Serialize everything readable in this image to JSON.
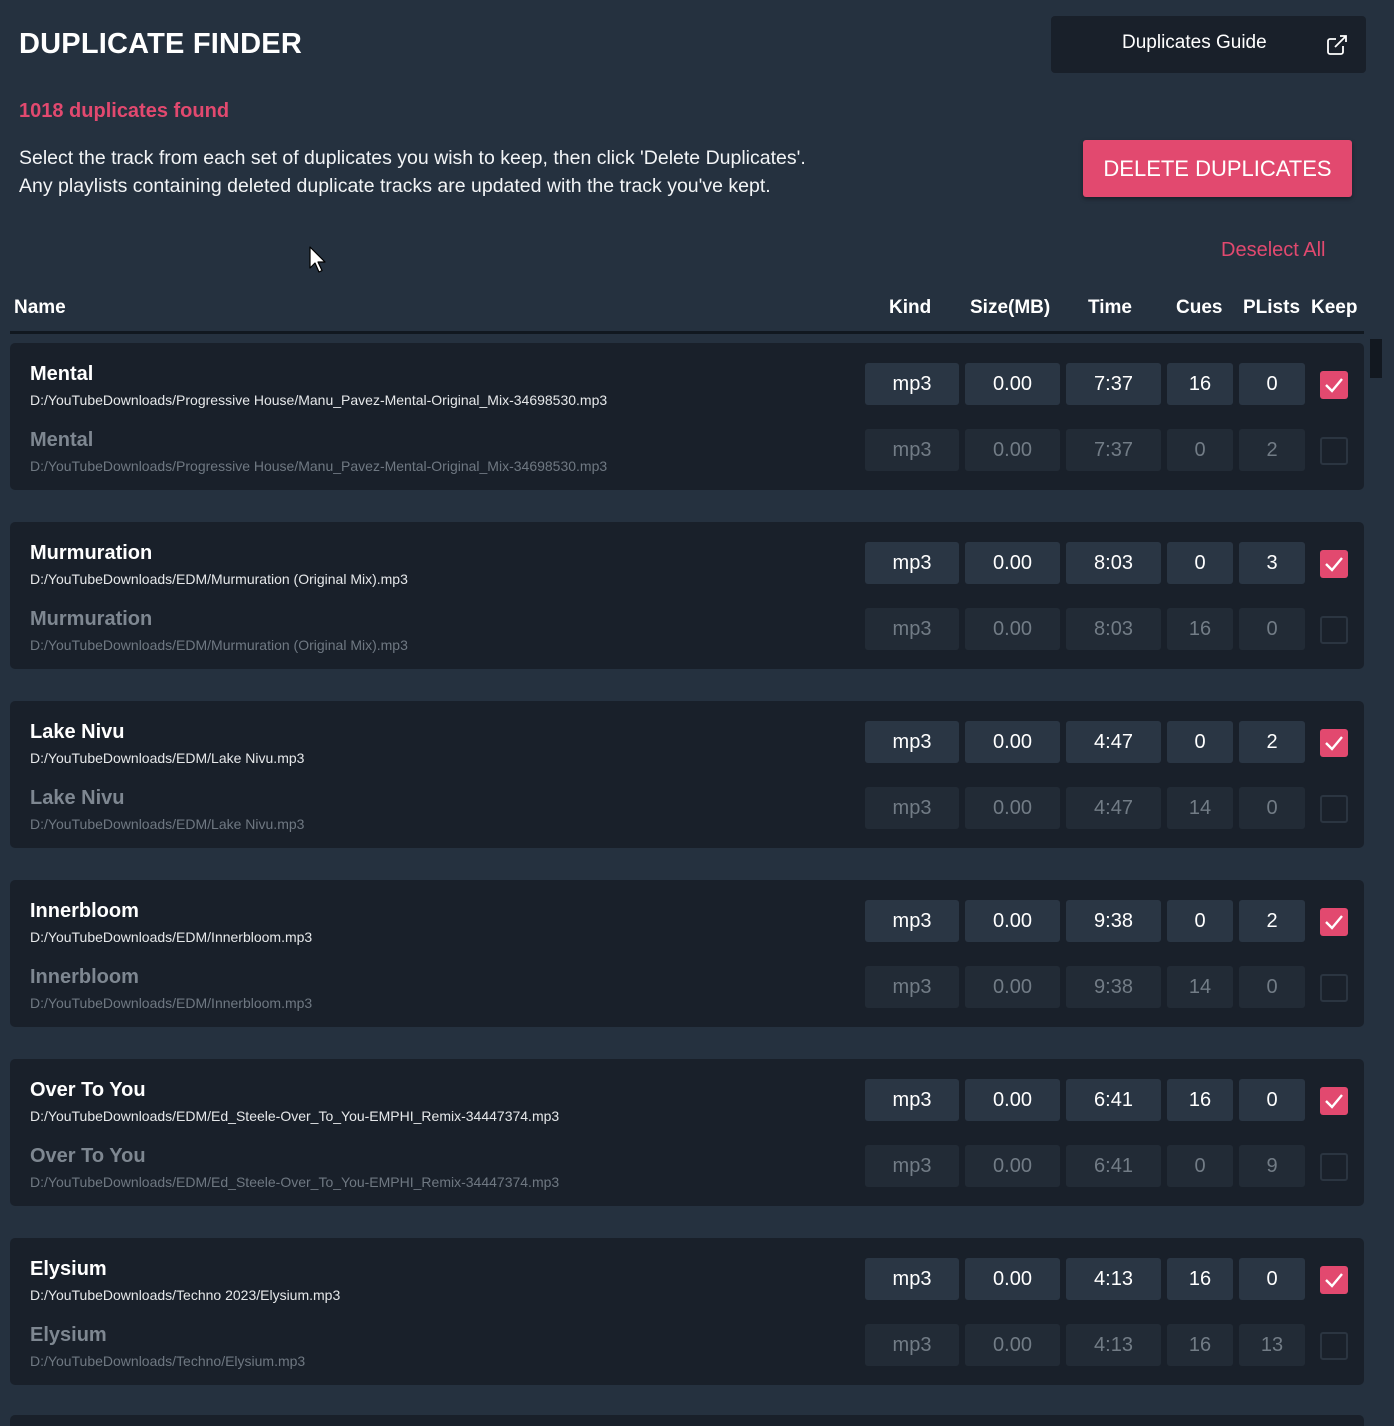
{
  "title": "DUPLICATE FINDER",
  "guide_button": {
    "label": "Duplicates Guide",
    "icon": "external-link-icon"
  },
  "count_text": "1018 duplicates found",
  "instructions": [
    "Select the track from each set of duplicates you wish to keep, then click 'Delete Duplicates'.",
    "Any playlists containing deleted duplicate tracks are updated with the track you've kept."
  ],
  "delete_button": {
    "label": "DELETE DUPLICATES"
  },
  "deselect_all": "Deselect All",
  "columns": [
    "Name",
    "Kind",
    "Size(MB)",
    "Time",
    "Cues",
    "PLists",
    "Keep"
  ],
  "colors": {
    "accent": "#e2496f",
    "background": "#25313f",
    "card": "#19202a",
    "cell": "#2a3644"
  },
  "groups": [
    {
      "tracks": [
        {
          "name": "Mental",
          "path": "D:/YouTubeDownloads/Progressive House/Manu_Pavez-Mental-Original_Mix-34698530.mp3",
          "kind": "mp3",
          "size": "0.00",
          "time": "7:37",
          "cues": "16",
          "plists": "0",
          "keep": true
        },
        {
          "name": "Mental",
          "path": "D:/YouTubeDownloads/Progressive House/Manu_Pavez-Mental-Original_Mix-34698530.mp3",
          "kind": "mp3",
          "size": "0.00",
          "time": "7:37",
          "cues": "0",
          "plists": "2",
          "keep": false
        }
      ]
    },
    {
      "tracks": [
        {
          "name": "Murmuration",
          "path": "D:/YouTubeDownloads/EDM/Murmuration (Original Mix).mp3",
          "kind": "mp3",
          "size": "0.00",
          "time": "8:03",
          "cues": "0",
          "plists": "3",
          "keep": true
        },
        {
          "name": "Murmuration",
          "path": "D:/YouTubeDownloads/EDM/Murmuration (Original Mix).mp3",
          "kind": "mp3",
          "size": "0.00",
          "time": "8:03",
          "cues": "16",
          "plists": "0",
          "keep": false
        }
      ]
    },
    {
      "tracks": [
        {
          "name": "Lake Nivu",
          "path": "D:/YouTubeDownloads/EDM/Lake Nivu.mp3",
          "kind": "mp3",
          "size": "0.00",
          "time": "4:47",
          "cues": "0",
          "plists": "2",
          "keep": true
        },
        {
          "name": "Lake Nivu",
          "path": "D:/YouTubeDownloads/EDM/Lake Nivu.mp3",
          "kind": "mp3",
          "size": "0.00",
          "time": "4:47",
          "cues": "14",
          "plists": "0",
          "keep": false
        }
      ]
    },
    {
      "tracks": [
        {
          "name": "Innerbloom",
          "path": "D:/YouTubeDownloads/EDM/Innerbloom.mp3",
          "kind": "mp3",
          "size": "0.00",
          "time": "9:38",
          "cues": "0",
          "plists": "2",
          "keep": true
        },
        {
          "name": "Innerbloom",
          "path": "D:/YouTubeDownloads/EDM/Innerbloom.mp3",
          "kind": "mp3",
          "size": "0.00",
          "time": "9:38",
          "cues": "14",
          "plists": "0",
          "keep": false
        }
      ]
    },
    {
      "tracks": [
        {
          "name": "Over To You",
          "path": "D:/YouTubeDownloads/EDM/Ed_Steele-Over_To_You-EMPHI_Remix-34447374.mp3",
          "kind": "mp3",
          "size": "0.00",
          "time": "6:41",
          "cues": "16",
          "plists": "0",
          "keep": true
        },
        {
          "name": "Over To You",
          "path": "D:/YouTubeDownloads/EDM/Ed_Steele-Over_To_You-EMPHI_Remix-34447374.mp3",
          "kind": "mp3",
          "size": "0.00",
          "time": "6:41",
          "cues": "0",
          "plists": "9",
          "keep": false
        }
      ]
    },
    {
      "tracks": [
        {
          "name": "Elysium",
          "path": "D:/YouTubeDownloads/Techno 2023/Elysium.mp3",
          "kind": "mp3",
          "size": "0.00",
          "time": "4:13",
          "cues": "16",
          "plists": "0",
          "keep": true
        },
        {
          "name": "Elysium",
          "path": "D:/YouTubeDownloads/Techno/Elysium.mp3",
          "kind": "mp3",
          "size": "0.00",
          "time": "4:13",
          "cues": "16",
          "plists": "13",
          "keep": false
        }
      ]
    }
  ]
}
